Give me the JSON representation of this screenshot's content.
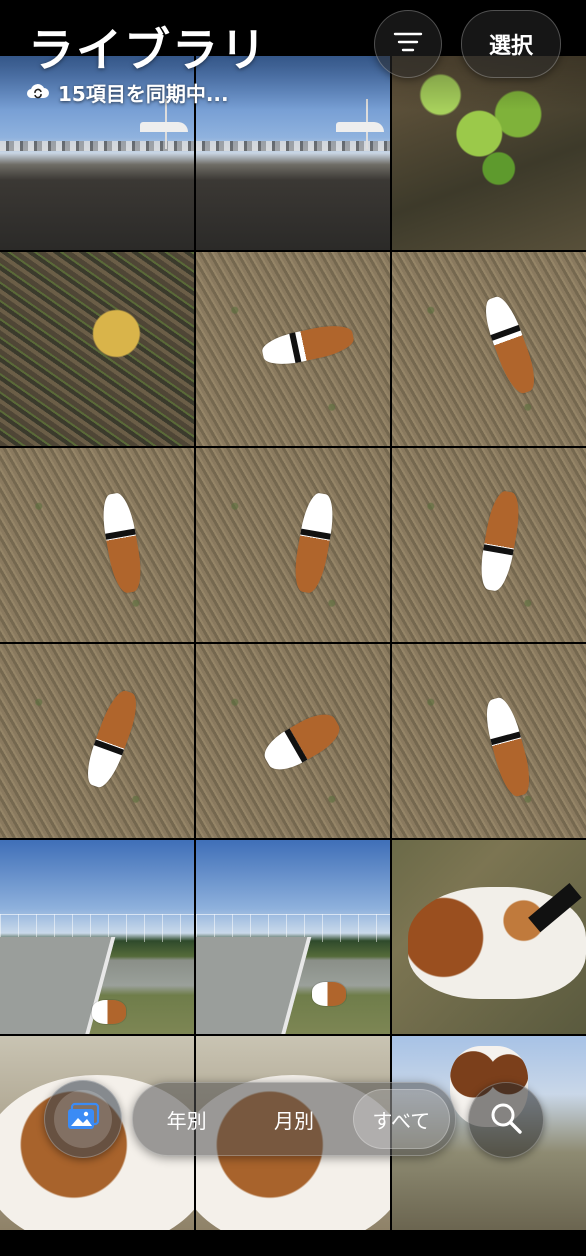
{
  "header": {
    "title": "ライブラリ",
    "sync_status": "15項目を同期中...",
    "filter_icon": "filter-lines-icon",
    "select_label": "選択"
  },
  "photos": [
    {
      "kind": "parking",
      "desc_icon": "photo"
    },
    {
      "kind": "parking",
      "desc_icon": "photo"
    },
    {
      "kind": "leaves",
      "desc_icon": "photo"
    },
    {
      "kind": "leafy-ground",
      "desc_icon": "photo"
    },
    {
      "kind": "grass-dog",
      "desc_icon": "photo"
    },
    {
      "kind": "grass-dog",
      "desc_icon": "photo"
    },
    {
      "kind": "grass-dog",
      "desc_icon": "photo"
    },
    {
      "kind": "grass-dog",
      "desc_icon": "photo"
    },
    {
      "kind": "grass-dog",
      "desc_icon": "photo"
    },
    {
      "kind": "grass-dog",
      "desc_icon": "photo"
    },
    {
      "kind": "grass-dog",
      "desc_icon": "photo"
    },
    {
      "kind": "grass-dog",
      "desc_icon": "photo"
    },
    {
      "kind": "park",
      "desc_icon": "photo"
    },
    {
      "kind": "park",
      "desc_icon": "photo"
    },
    {
      "kind": "closeup",
      "desc_icon": "photo"
    },
    {
      "kind": "close-dog",
      "desc_icon": "photo"
    },
    {
      "kind": "close-dog",
      "desc_icon": "photo"
    },
    {
      "kind": "beagle-face",
      "desc_icon": "photo"
    }
  ],
  "bottom_bar": {
    "library_icon": "photo-library-icon",
    "segments": [
      "年別",
      "月別",
      "すべて"
    ],
    "active_segment": "すべて",
    "search_icon": "search-icon"
  }
}
